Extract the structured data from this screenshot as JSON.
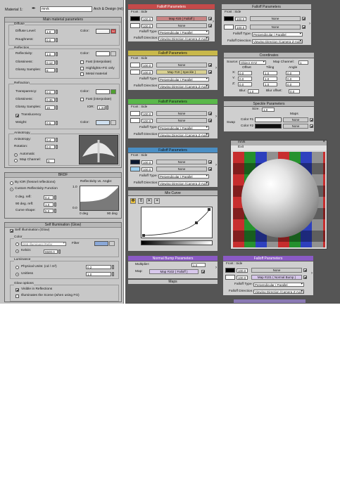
{
  "material_bar": {
    "label": "Material 1:",
    "name": "mrvk",
    "type": "Arch & Design (mi)"
  },
  "main_params": {
    "title": "Main material parameters",
    "diffuse": {
      "group": "Diffuse",
      "level_label": "Diffuse Level:",
      "level": "1,0",
      "roughness_label": "Roughness:",
      "roughness": "0,0",
      "color_label": "Color:",
      "color": "#f2f2f2",
      "map_letter": "M"
    },
    "reflection": {
      "group": "Reflection",
      "refl_label": "Reflectivity:",
      "refl": "1,0",
      "gloss_label": "Glossiness:",
      "gloss": "0,12",
      "samples_label": "Glossy Samples:",
      "samples": "8",
      "color_label": "Color:",
      "color": "#ffffff",
      "fast_label": "Fast (interpolate)",
      "highlights_label": "Highlights+FG only",
      "metal_label": "Metal material"
    },
    "refraction": {
      "group": "Refraction",
      "transp_label": "Transparency:",
      "transp": "0,0",
      "gloss_label": "Glossiness:",
      "gloss": "0,35",
      "samples_label": "Glossy Samples:",
      "samples": "16",
      "color_label": "Color:",
      "color": "#ffffff",
      "fast_label": "Fast (interpolate)",
      "ior_label": "IOR:",
      "ior": "1,33",
      "translucency_label": "Translucency",
      "weight_label": "Weight:",
      "weight": "0,5",
      "tcolor_label": "Color:",
      "tcolor": "#cfe0f0"
    },
    "anisotropy": {
      "group": "Anisotropy",
      "aniso_label": "Anisotropy:",
      "aniso": "0,4",
      "rot_label": "Rotation:",
      "rot": "0,0",
      "auto_label": "Automatic",
      "map_label": "Map Channel:",
      "map_val": "0"
    }
  },
  "brdf": {
    "title": "BRDF",
    "by_ior": "By IOR (fresnel reflections)",
    "custom": "Custom Reflectivity Function",
    "deg0_label": "0 deg. refl:",
    "deg0": "0,4",
    "deg90_label": "90 deg. refl:",
    "deg90": "1,0",
    "curve_label": "Curve shape:",
    "curve": "5,0",
    "graph_title": "Reflectivity vs. Angle:",
    "y_top": "1.0",
    "y_bot": "0.0",
    "x_left": "0 deg",
    "x_right": "90 deg"
  },
  "self_illum": {
    "title": "Self Illumination (Glow)",
    "enable": "Self Illumination (Glow)",
    "color_group": "Color",
    "d65": "D65 Illuminant (Refer",
    "filter_label": "Filter",
    "kelvin": "Kelvin:",
    "kelvin_val": "6500,0",
    "lum_group": "Luminance",
    "physical": "Physical Units: (cd / m²)",
    "physical_val": "0,2",
    "unitless": "Unitless",
    "unitless_val": "1,0",
    "glow_group": "Glow options",
    "visible": "Visible in Reflections",
    "illuminates": "Illuminates the Scene (when using FG)"
  },
  "falloff_nodes": [
    {
      "title": "Falloff Parameters",
      "color": "#c44a4a",
      "front_side": "Front : Side",
      "v1": "100,0",
      "map1": "Map #20  ( Falloff )",
      "v2": "100,0",
      "map2": "None",
      "type_label": "Falloff Type:",
      "type": "Perpendicular / Parallel",
      "dir_label": "Falloff Direction:",
      "dir": "Viewing Direction (Camera Z-Axis)"
    },
    {
      "title": "Falloff Parameters",
      "color": "#c8c8c8",
      "front_side": "Front : Side",
      "v1": "100,0",
      "map1": "None",
      "v2": "100,0",
      "map2": "None",
      "type_label": "Falloff Type:",
      "type": "Perpendicular / Parallel",
      "dir_label": "Falloff Direction:",
      "dir": "Viewing Direction (Camera Z-Axis)"
    },
    {
      "title": "Falloff Parameters",
      "color": "#c8b84a",
      "front_side": "Front : Side",
      "v1": "100,0",
      "map1": "None",
      "v2": "100,0",
      "map2": "Map #18  ( Speckle )",
      "type_label": "Falloff Type:",
      "type": "Perpendicular / Parallel",
      "dir_label": "Falloff Direction:",
      "dir": "Viewing Direction (Camera Z-Axis)"
    },
    {
      "title": "Falloff Parameters",
      "color": "#5ab84a",
      "front_side": "Front : Side",
      "v1": "100,0",
      "map1": "None",
      "v2": "100,0",
      "map2": "None",
      "type_label": "Falloff Type:",
      "type": "Perpendicular / Parallel",
      "dir_label": "Falloff Direction:",
      "dir": "Viewing Direction (Camera Z-Axis)"
    },
    {
      "title": "Falloff Parameters",
      "color": "#4a8ec4",
      "front_side": "Front : Side",
      "v1": "100,0",
      "map1": "None",
      "v2": "100,0",
      "map2": "None",
      "type_label": "Falloff Type:",
      "type": "Perpendicular / Parallel",
      "dir_label": "Falloff Direction:",
      "dir": "Viewing Direction (Camera Z-Axis)"
    },
    {
      "title": "Falloff Parameters",
      "color": "#8a5ac4",
      "front_side": "Front : Side",
      "v1": "100,0",
      "map1": "None",
      "v2": "100,0",
      "map2": "Map #101  ( Normal Bump )",
      "type_label": "Falloff Type:",
      "type": "Perpendicular / Parallel",
      "dir_label": "Falloff Direction:",
      "dir": "Viewing Direction (Camera Z-Axis)"
    }
  ],
  "coords": {
    "title": "Coordinates",
    "source_label": "Source:",
    "source": "Object XYZ",
    "mapch_label": "Map Channel:",
    "mapch": "1",
    "offset": "Offset",
    "tiling": "Tiling",
    "angle": "Angle",
    "x": "X:",
    "y": "Y:",
    "z": "Z:",
    "offx": "0,0",
    "offy": "0,0",
    "offz": "0,0",
    "tx": "1,0",
    "ty": "1,0",
    "tz": "1,0",
    "ax": "0,0",
    "ay": "0,0",
    "az": "0,0",
    "blur_label": "Blur:",
    "blur": "1,0",
    "bluroff_label": "Blur offset:",
    "bluroff": "0,0"
  },
  "speckle": {
    "title": "Speckle Parameters",
    "size_label": "Size:",
    "size": "1,0",
    "maps_label": "Maps",
    "swap": "Swap",
    "c1_label": "Color #1",
    "c2_label": "Color #2",
    "c1_map": "None",
    "c2_map": "None",
    "c1": "#f0f0f0",
    "c2": "#101010"
  },
  "preview": {
    "title": "mrvk",
    "menu": "Exit"
  },
  "mix_curve": {
    "title": "Mix Curve"
  },
  "bump": {
    "title": "Normal Bump Parameters",
    "mult_label": "Multiplier:",
    "mult": "1,0",
    "map_label": "Map:",
    "map": "Map #102  ( Falloff )"
  },
  "maps": {
    "title": "Maps"
  }
}
